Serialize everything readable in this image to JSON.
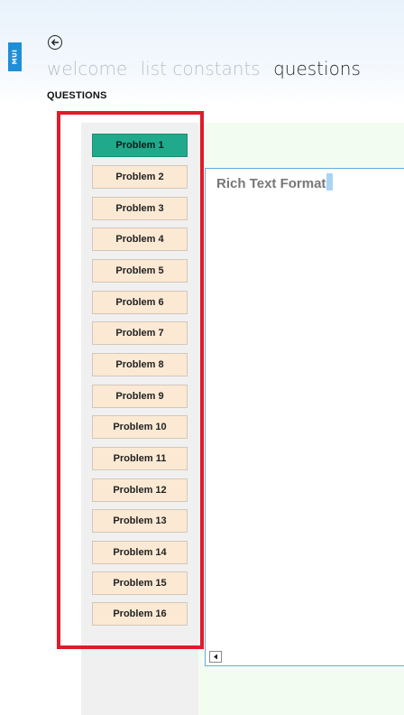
{
  "app": {
    "badge": "MUI"
  },
  "nav": {
    "back_icon": "back-arrow-circle-icon",
    "tabs": [
      {
        "label": "welcome",
        "active": false
      },
      {
        "label": "list constants",
        "active": false
      },
      {
        "label": "questions",
        "active": true
      }
    ]
  },
  "page_title": "QUESTIONS",
  "problems": [
    {
      "label": "Problem 1",
      "selected": true
    },
    {
      "label": "Problem 2",
      "selected": false
    },
    {
      "label": "Problem 3",
      "selected": false
    },
    {
      "label": "Problem 4",
      "selected": false
    },
    {
      "label": "Problem 5",
      "selected": false
    },
    {
      "label": "Problem 6",
      "selected": false
    },
    {
      "label": "Problem 7",
      "selected": false
    },
    {
      "label": "Problem 8",
      "selected": false
    },
    {
      "label": "Problem 9",
      "selected": false
    },
    {
      "label": "Problem 10",
      "selected": false
    },
    {
      "label": "Problem 11",
      "selected": false
    },
    {
      "label": "Problem 12",
      "selected": false
    },
    {
      "label": "Problem 13",
      "selected": false
    },
    {
      "label": "Problem 14",
      "selected": false
    },
    {
      "label": "Problem 15",
      "selected": false
    },
    {
      "label": "Problem 16",
      "selected": false
    }
  ],
  "editor": {
    "text": "Rich Text Format"
  },
  "colors": {
    "accent": "#1e8fd7",
    "selected_problem": "#21a98b",
    "problem_bg": "#fbe9d4",
    "highlight": "#e01b2a"
  }
}
